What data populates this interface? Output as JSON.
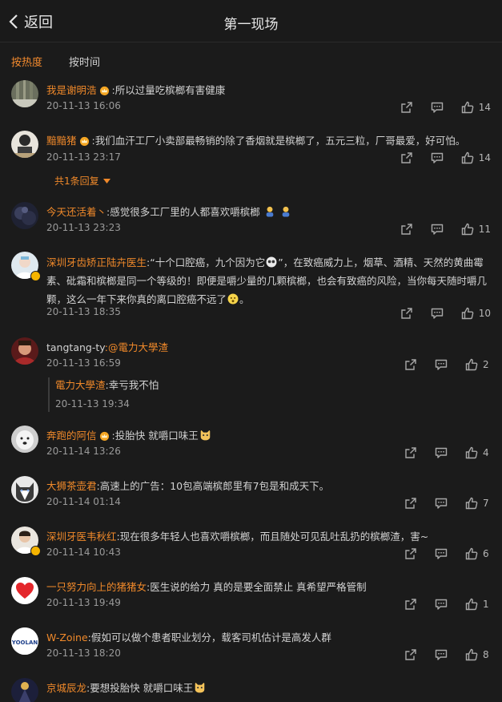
{
  "header": {
    "back_label": "返回",
    "title": "第一现场"
  },
  "sort": {
    "hot": "按热度",
    "time": "按时间"
  },
  "comments": [
    {
      "user": "我是谢明浩",
      "text": ":所以过量吃槟榔有害健康",
      "time": "20-11-13 16:06",
      "likes": "14"
    },
    {
      "user": "黯黯猪",
      "text": ":我们血汗工厂小卖部最畅销的除了香烟就是槟榔了，五元三粒，厂哥最爱，好可怕。",
      "time": "20-11-13 23:17",
      "likes": "14",
      "replies": "共1条回复"
    },
    {
      "user": "今天还活着丶",
      "text": ":感觉很多工厂里的人都喜欢嚼槟榔",
      "time": "20-11-13 23:23",
      "likes": "11"
    },
    {
      "user": "深圳牙齿矫正陆卉医生",
      "text_a": ":“十个口腔癌，九个因为它",
      "text_b": "”，在致癌威力上，烟草、酒精、天然的黄曲霉素、砒霜和槟榔是同一个等级的！即便是嚼少量的几颗槟榔，也会有致癌的风险，当你每天随时嚼几颗，这么一年下来你真的离口腔癌不远了",
      "time": "20-11-13 18:35",
      "likes": "10"
    },
    {
      "user": "tangtang-ty",
      "text": ":@電力大學渣",
      "time": "20-11-13 16:59",
      "likes": "2",
      "quote": {
        "user": "電力大學渣",
        "text": ":幸亏我不怕",
        "time": "20-11-13 19:34"
      }
    },
    {
      "user": "奔跑的阿信",
      "text": ":投胎快 就嚼口味王",
      "time": "20-11-14 13:26",
      "likes": "4"
    },
    {
      "user": "大狮茶壶君",
      "text": ":高速上的广告：10包高端槟郎里有7包是和成天下。",
      "time": "20-11-14 01:14",
      "likes": "7"
    },
    {
      "user": "深圳牙医韦秋红",
      "text": ":现在很多年轻人也喜欢嚼槟榔，而且随处可见乱吐乱扔的槟榔渣，害~",
      "time": "20-11-14 10:43",
      "likes": "6"
    },
    {
      "user": "一只努力向上的猪猪女",
      "text": ":医生说的给力  真的是要全面禁止   真希望严格管制",
      "time": "20-11-13 19:49",
      "likes": "1"
    },
    {
      "user": "W-Zoine",
      "text": ":假如可以做个患者职业划分，载客司机估计是高发人群",
      "time": "20-11-13 18:20",
      "likes": "8"
    },
    {
      "user": "京城辰龙",
      "text": ":要想投胎快 就嚼口味王"
    }
  ],
  "avatar_text": {
    "wzoine": "YOOLAN"
  },
  "icons": {
    "share": "share-icon",
    "comment": "comment-icon",
    "like": "like-icon",
    "back": "chevron-left-icon",
    "crown": "crown-badge-icon"
  },
  "colors": {
    "accent": "#f0892a",
    "background": "#1b1b1b",
    "muted": "#9a9a9a"
  }
}
